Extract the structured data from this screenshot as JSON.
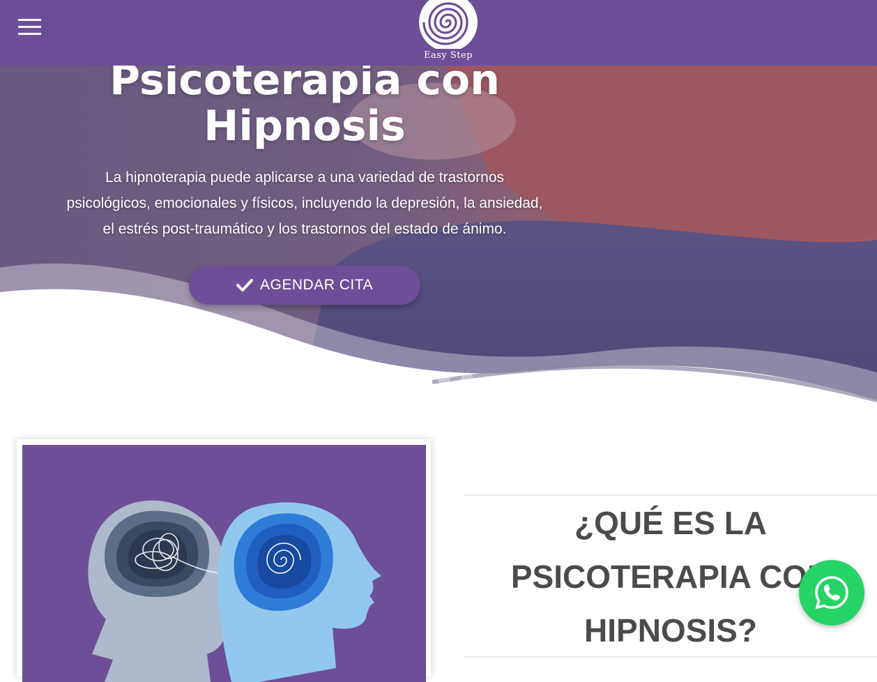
{
  "header": {
    "menu_icon": "hamburger-menu-icon",
    "logo_text": "Easy Step",
    "background": "#6c4f96"
  },
  "hero": {
    "title_line1": "Psicoterapia con",
    "title_line2": "Hipnosis",
    "description_line1": "La hipnoterapia puede aplicarse a una variedad de trastornos",
    "description_line2": "psicológicos, emocionales y físicos, incluyendo la depresión, la ansiedad,",
    "description_line3": "el estrés post-traumático y los trastornos del estado de ánimo.",
    "cta_label": "AGENDAR CITA",
    "cta_icon": "checkmark-icon",
    "slides_total": 3,
    "slide_active": 1
  },
  "about": {
    "title_line1": "¿QUÉ ES LA",
    "title_line2": "PSICOTERAPIA CON",
    "title_line3": "HIPNOSIS?"
  },
  "whatsapp": {
    "icon": "whatsapp-icon",
    "color": "#25d366"
  },
  "colors": {
    "brand_purple": "#6c4f96",
    "heading_gray": "#4b4b4b"
  }
}
